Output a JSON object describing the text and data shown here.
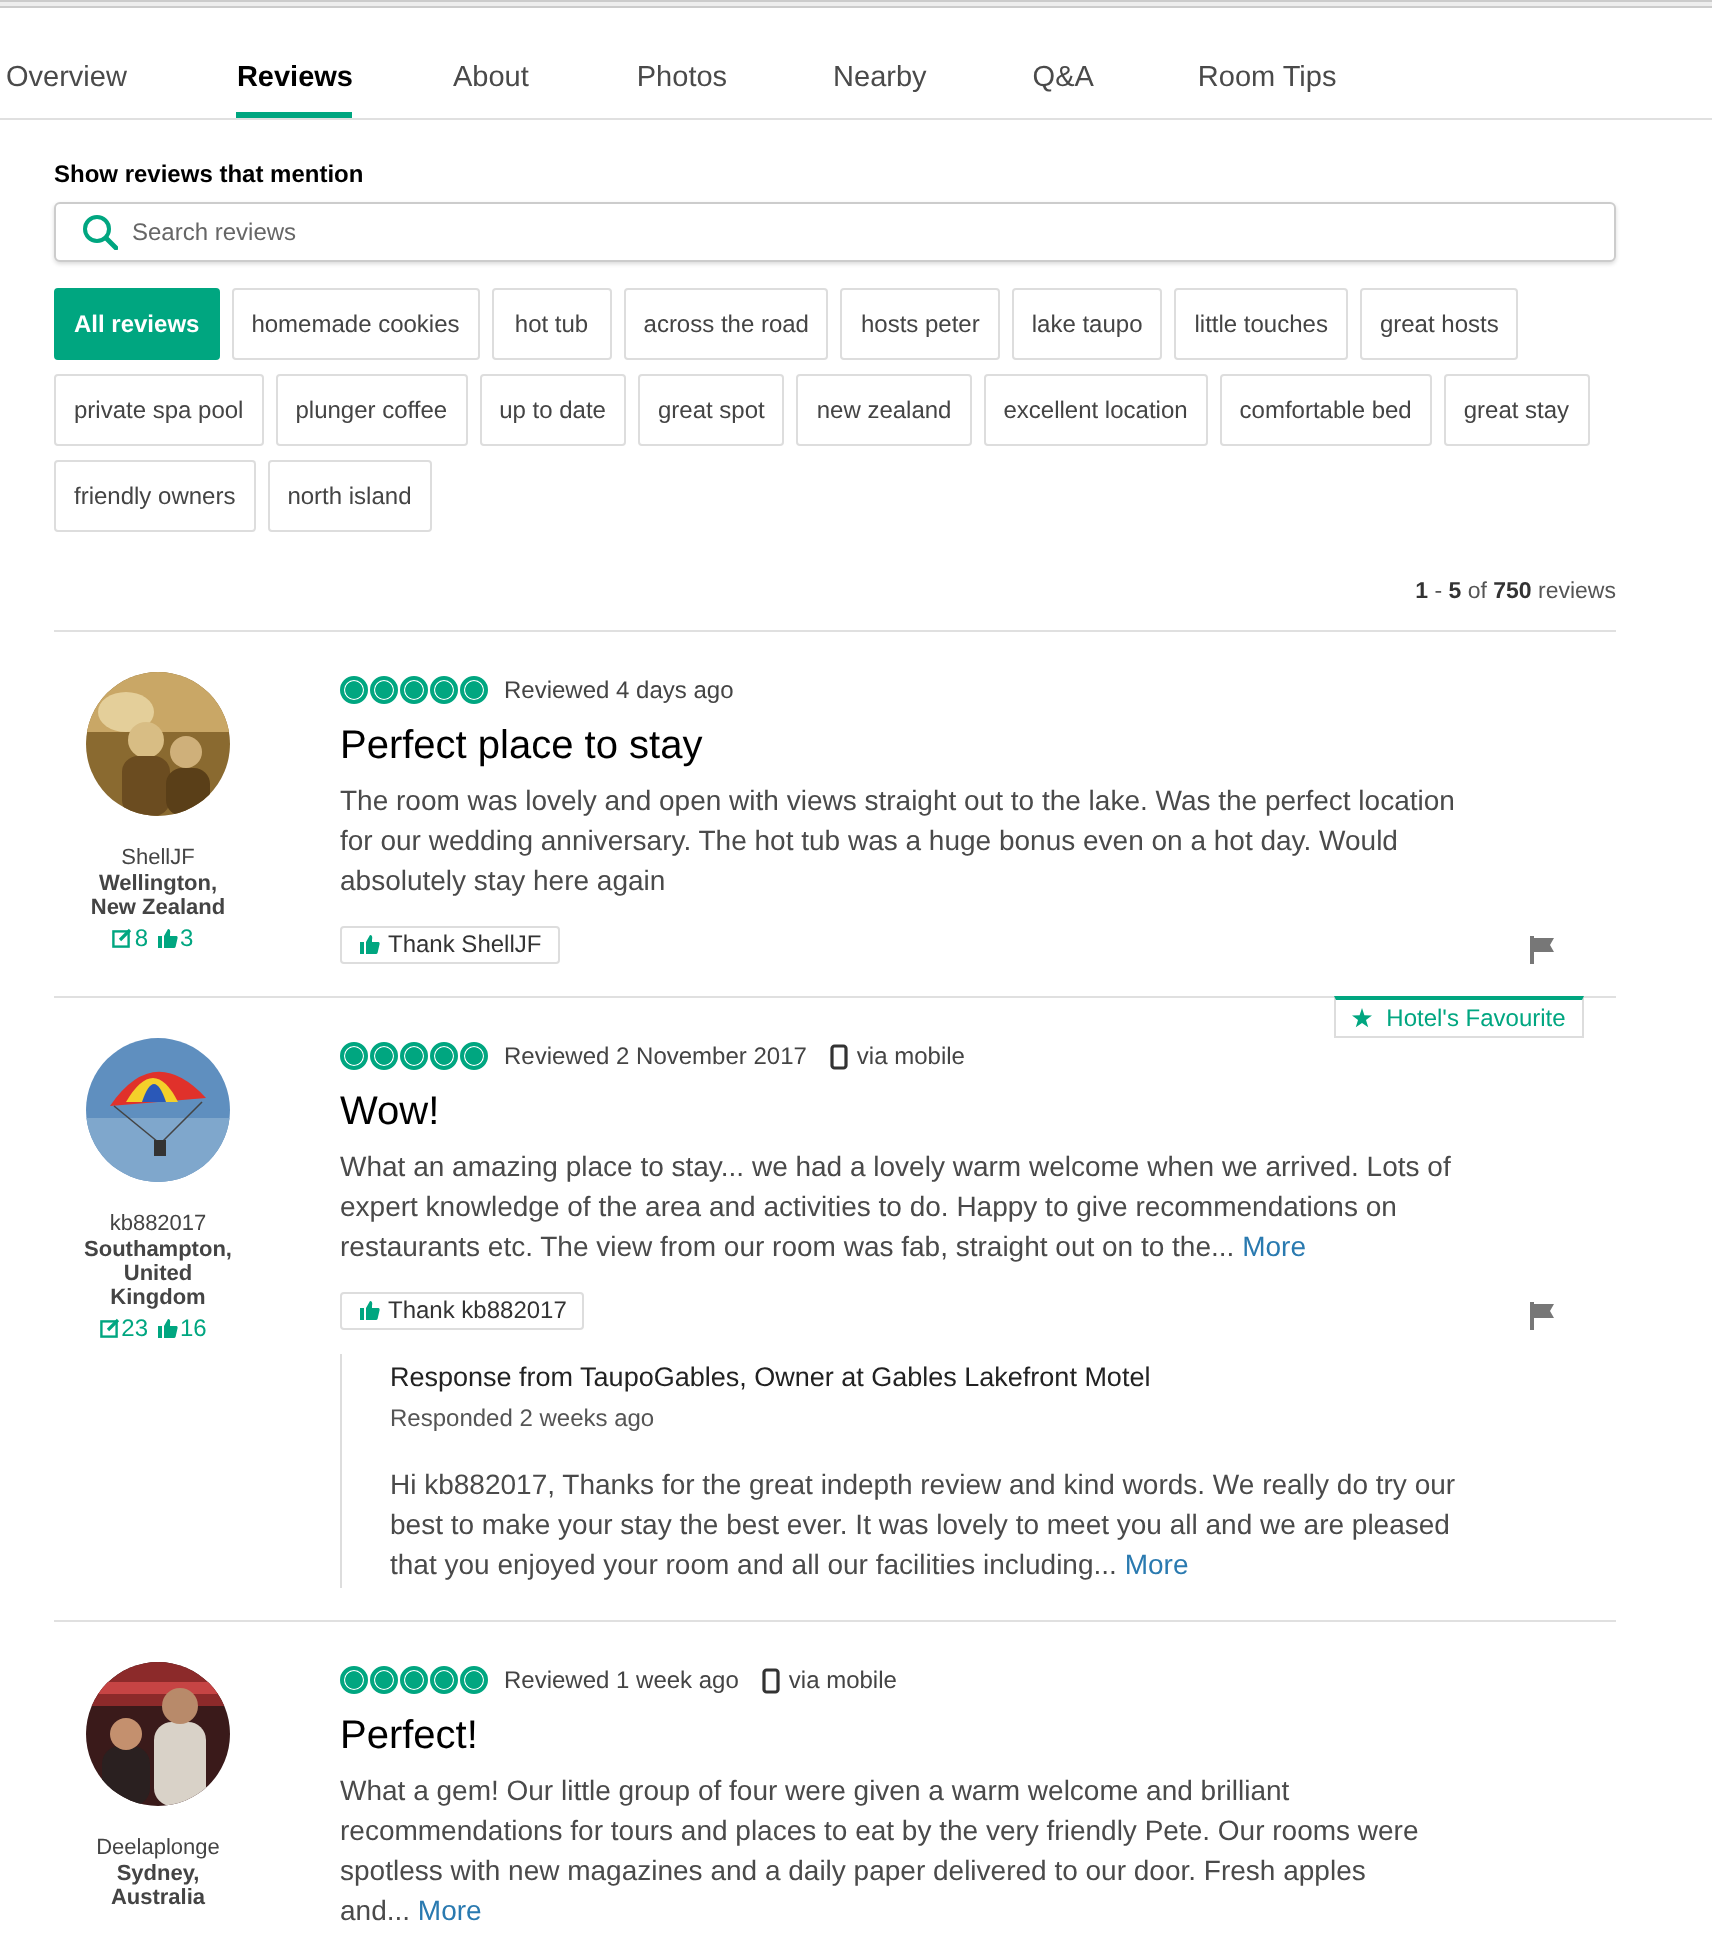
{
  "tabs": [
    {
      "label": "Overview",
      "selected": false
    },
    {
      "label": "Reviews",
      "selected": true
    },
    {
      "label": "About",
      "selected": false
    },
    {
      "label": "Photos",
      "selected": false
    },
    {
      "label": "Nearby",
      "selected": false
    },
    {
      "label": "Q&A",
      "selected": false
    },
    {
      "label": "Room Tips",
      "selected": false
    }
  ],
  "filter": {
    "heading": "Show reviews that mention",
    "search": {
      "placeholder": "Search reviews"
    },
    "tags": [
      {
        "label": "All reviews",
        "selected": true
      },
      {
        "label": "homemade cookies",
        "selected": false
      },
      {
        "label": "hot tub",
        "selected": false
      },
      {
        "label": "across the road",
        "selected": false
      },
      {
        "label": "hosts peter",
        "selected": false
      },
      {
        "label": "lake taupo",
        "selected": false
      },
      {
        "label": "little touches",
        "selected": false
      },
      {
        "label": "great hosts",
        "selected": false
      },
      {
        "label": "private spa pool",
        "selected": false
      },
      {
        "label": "plunger coffee",
        "selected": false
      },
      {
        "label": "up to date",
        "selected": false
      },
      {
        "label": "great spot",
        "selected": false
      },
      {
        "label": "new zealand",
        "selected": false
      },
      {
        "label": "excellent location",
        "selected": false
      },
      {
        "label": "comfortable bed",
        "selected": false
      },
      {
        "label": "great stay",
        "selected": false
      },
      {
        "label": "friendly owners",
        "selected": false
      },
      {
        "label": "north island",
        "selected": false
      }
    ]
  },
  "count": "**1** - **5** of **750** reviews",
  "reviews": [
    {
      "user": {
        "name": "ShellJF",
        "location": "Wellington, New Zealand",
        "contributions": "8",
        "helpful": "3"
      },
      "stars": 5,
      "date": "Reviewed 4 days ago",
      "title": "Perfect place to stay",
      "body": "The room was lovely and open with views straight out to the lake. Was the perfect location for our wedding anniversary. The hot tub was a huge bonus even on a hot day. Would absolutely stay here again",
      "thank": "Thank ShellJF"
    },
    {
      "user": {
        "name": "kb882017",
        "location": "Southampton, United Kingdom",
        "contributions": "23",
        "helpful": "16"
      },
      "stars": 5,
      "date": "Reviewed 2 November 2017",
      "device": "via mobile",
      "badge": "Hotel's Favourite",
      "title": "Wow!",
      "body": "What an amazing place to stay... we had a lovely warm welcome when we arrived. Lots of expert knowledge of the area and activities to do. Happy to give recommendations on restaurants etc. The view from our room was fab, straight out on to the...",
      "more": "More",
      "thank": "Thank kb882017",
      "response": {
        "title": "Response from TaupoGables, Owner at Gables Lakefront Motel",
        "date": "Responded 2 weeks ago",
        "body": "Hi kb882017, Thanks for the great indepth review and kind words. We really do try our best to make your stay the best ever. It was lovely to meet you all and we are pleased that you enjoyed your room and all our facilities including...",
        "more": "More"
      }
    },
    {
      "user": {
        "name": "Deelaplonge",
        "location": "Sydney, Australia"
      },
      "stars": 5,
      "date": "Reviewed 1 week ago",
      "device": "via mobile",
      "title": "Perfect!",
      "body": "What a gem! Our little group of four were given a warm welcome and brilliant recommendations for tours and places to eat by the very friendly Pete. Our rooms were spotless with new magazines and a daily paper delivered to our door. Fresh apples and...",
      "more": "More"
    }
  ]
}
